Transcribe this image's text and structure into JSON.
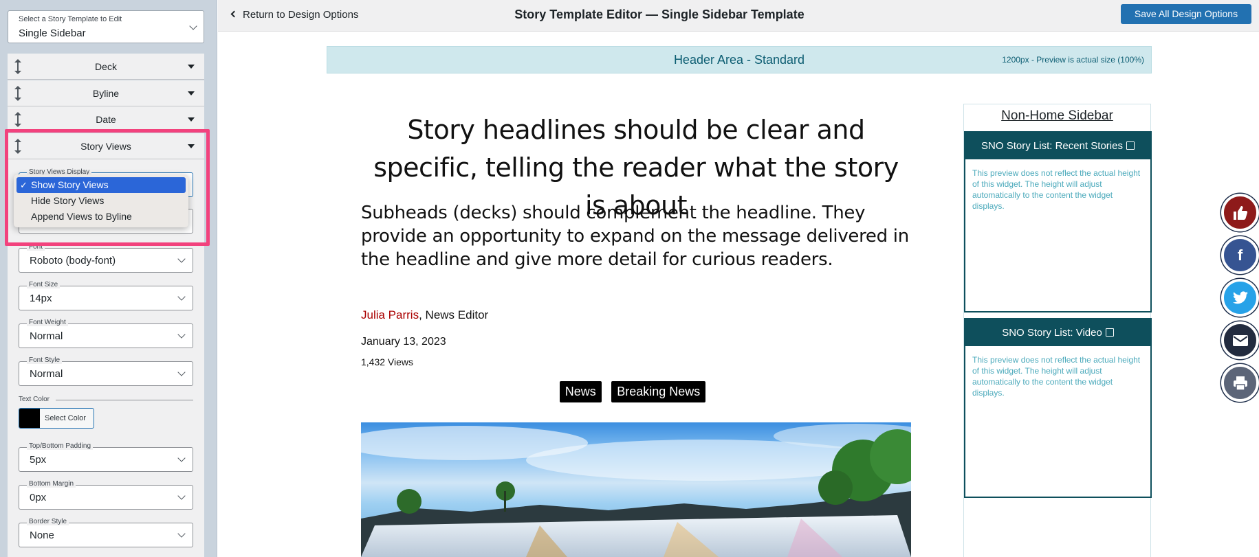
{
  "sidebar": {
    "template_select": {
      "label": "Select a Story Template to Edit",
      "value": "Single Sidebar"
    },
    "accordions": [
      {
        "label": "Deck"
      },
      {
        "label": "Byline"
      },
      {
        "label": "Date"
      },
      {
        "label": "Story Views"
      }
    ],
    "story_views_display": {
      "label": "Story Views Display",
      "options": [
        "Show Story Views",
        "Hide Story Views",
        "Append Views to Byline"
      ],
      "selected": "Show Story Views"
    },
    "fields": {
      "font": {
        "label": "Font",
        "value": "Roboto (body-font)"
      },
      "font_size": {
        "label": "Font Size",
        "value": "14px"
      },
      "font_weight": {
        "label": "Font Weight",
        "value": "Normal"
      },
      "font_style": {
        "label": "Font Style",
        "value": "Normal"
      },
      "text_color": {
        "label": "Text Color",
        "button": "Select Color",
        "value": "#000000"
      },
      "top_bottom_padding": {
        "label": "Top/Bottom Padding",
        "value": "5px"
      },
      "bottom_margin": {
        "label": "Bottom Margin",
        "value": "0px"
      },
      "border_style": {
        "label": "Border Style",
        "value": "None"
      }
    }
  },
  "header": {
    "back_link": "Return to Design Options",
    "title": "Story Template Editor — Single Sidebar Template",
    "save_button": "Save All Design Options"
  },
  "preview": {
    "header_area": {
      "title": "Header Area - Standard",
      "note": "1200px - Preview is actual size (100%)"
    },
    "headline": "Story headlines should be clear and specific, telling the reader what the story is about",
    "deck": "Subheads (decks) should complement the headline. They provide an opportunity to expand on the message delivered in the headline and give more detail for curious readers.",
    "byline": {
      "author": "Julia Parris",
      "role": ", News Editor"
    },
    "date": "January 13, 2023",
    "views": "1,432 Views",
    "tags": [
      "News",
      "Breaking News"
    ]
  },
  "right_sidebar": {
    "title": "Non-Home Sidebar",
    "widgets": [
      {
        "title": "SNO Story List: Recent Stories",
        "body": "This preview does not reflect the actual height of this widget. The height will adjust automatically to the content the widget displays."
      },
      {
        "title": "SNO Story List: Video",
        "body": "This preview does not reflect the actual height of this widget. The height will adjust automatically to the content the widget displays."
      }
    ]
  },
  "social_buttons": [
    "thumbs-up-icon",
    "facebook-icon",
    "twitter-icon",
    "envelope-icon",
    "print-icon"
  ],
  "colors": {
    "accent": "#2271b1",
    "highlight": "#f2427d",
    "widget_header": "#0e4f5c",
    "author": "#aa0000"
  }
}
